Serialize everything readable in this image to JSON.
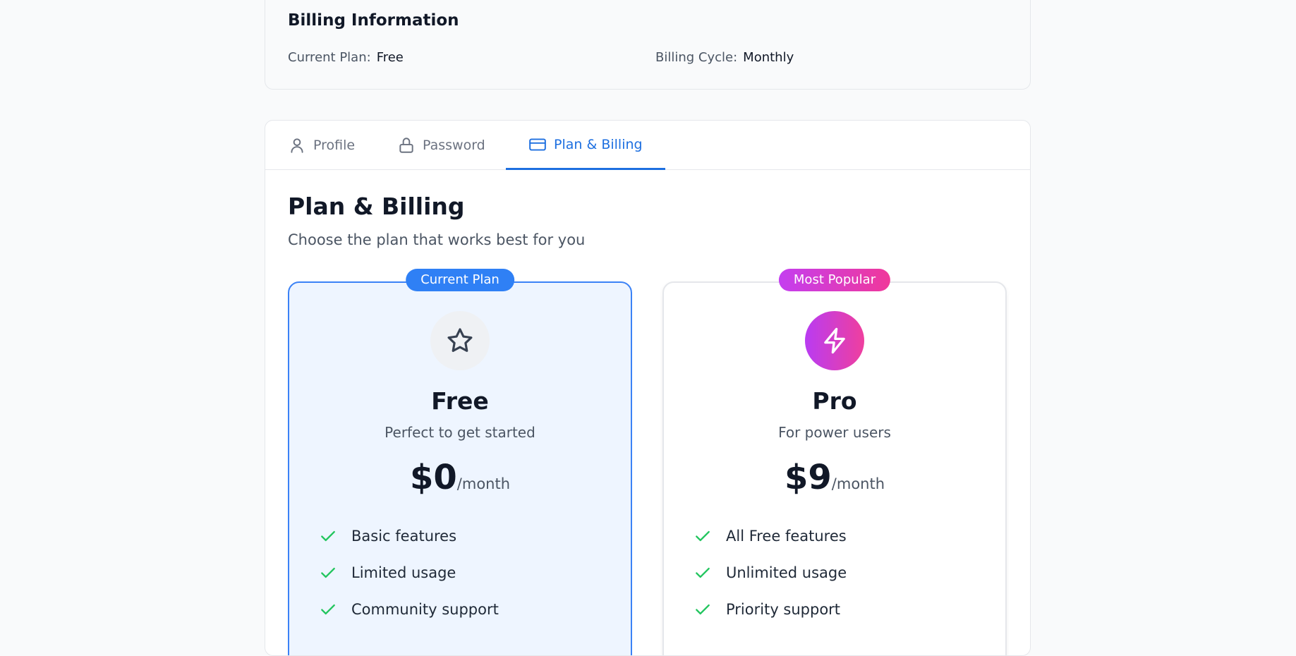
{
  "billing": {
    "title": "Billing Information",
    "current_plan_label": "Current Plan:",
    "current_plan_value": "Free",
    "cycle_label": "Billing Cycle:",
    "cycle_value": "Monthly"
  },
  "tabs": [
    {
      "label": "Profile",
      "icon": "user-icon",
      "active": false
    },
    {
      "label": "Password",
      "icon": "lock-icon",
      "active": false
    },
    {
      "label": "Plan & Billing",
      "icon": "credit-card-icon",
      "active": true
    }
  ],
  "section": {
    "title": "Plan & Billing",
    "subtitle": "Choose the plan that works best for you"
  },
  "plans": [
    {
      "badge": "Current Plan",
      "icon": "star-icon",
      "name": "Free",
      "description": "Perfect to get started",
      "price": "$0",
      "period": "/month",
      "features": [
        "Basic features",
        "Limited usage",
        "Community support"
      ]
    },
    {
      "badge": "Most Popular",
      "icon": "lightning-icon",
      "name": "Pro",
      "description": "For power users",
      "price": "$9",
      "period": "/month",
      "features": [
        "All Free features",
        "Unlimited usage",
        "Priority support"
      ]
    }
  ],
  "colors": {
    "accent": "#1d6fe0",
    "check": "#22c55e",
    "pro_gradient_start": "#c43ef0",
    "pro_gradient_end": "#f0389a"
  }
}
